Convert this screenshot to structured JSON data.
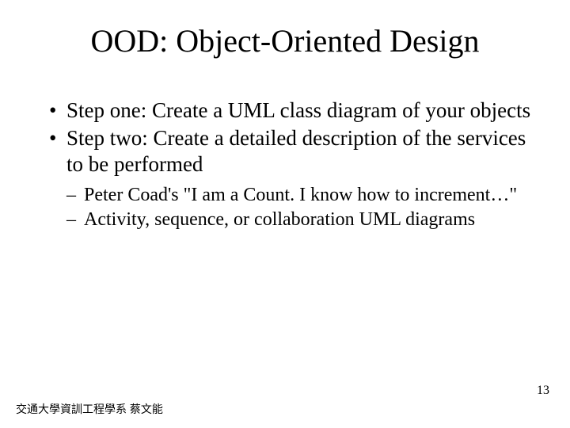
{
  "slide": {
    "title": "OOD: Object-Oriented Design",
    "bullets": [
      "Step one: Create a UML class diagram of your objects",
      "Step two: Create a detailed description of the services to be performed"
    ],
    "subbullets": [
      "Peter Coad's \"I am a Count. I know how to increment…\"",
      "Activity, sequence, or collaboration UML diagrams"
    ],
    "footer_left": "交通大學資訓工程學系 蔡文能",
    "page_number": "13"
  }
}
